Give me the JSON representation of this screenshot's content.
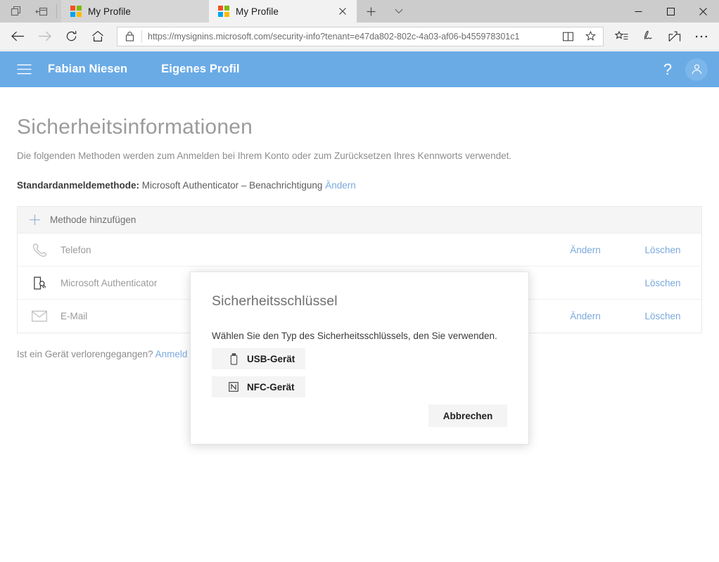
{
  "window": {
    "tabs": [
      {
        "title": "My Profile",
        "active": false,
        "favicon": "microsoft-logo-icon"
      },
      {
        "title": "My Profile",
        "active": true,
        "favicon": "microsoft-logo-icon"
      }
    ],
    "new_tab_label": "+",
    "controls": {
      "minimize": "—",
      "maximize": "☐",
      "close": "✕"
    }
  },
  "toolbar": {
    "back": "back-arrow",
    "forward": "forward-arrow",
    "refresh": "refresh-arrow",
    "home": "home-icon",
    "url": "https://mysignins.microsoft.com/security-info?tenant=e47da802-802c-4a03-af06-b455978301c1",
    "url_domain": "mysignins.microsoft.com",
    "url_scheme": "https://",
    "url_path": "/security-info?tenant=e47da802-802c-4a03-af06-b455978301c1",
    "reading_view": "reading-view-icon",
    "favorite": "star-icon",
    "favorites_hub": "favorites-list-icon",
    "notes": "ink-note-icon",
    "share": "share-icon",
    "more": "⋯"
  },
  "appbar": {
    "menu": "hamburger-icon",
    "brand": "Fabian Niesen",
    "section": "Eigenes Profil",
    "help": "?",
    "avatar": "user-avatar",
    "bg_color": "#6aabe6"
  },
  "main": {
    "title": "Sicherheitsinformationen",
    "description": "Die folgenden Methoden werden zum Anmelden bei Ihrem Konto oder zum Zurücksetzen Ihres Kennworts verwendet.",
    "default_method": {
      "label": "Standardanmeldemethode:",
      "value": "Microsoft Authenticator – Benachrichtigung",
      "change_link": "Ändern"
    },
    "add_method_label": "Methode hinzufügen",
    "methods": [
      {
        "icon": "phone-icon",
        "name": "Telefon",
        "value": "",
        "change": "Ändern",
        "delete": "Löschen"
      },
      {
        "icon": "authenticator-icon",
        "name": "Microsoft Authenticator",
        "value": "",
        "change": "",
        "delete": "Löschen"
      },
      {
        "icon": "email-icon",
        "name": "E-Mail",
        "value": "",
        "change": "Ändern",
        "delete": "Löschen"
      }
    ],
    "lost_device": {
      "question": "Ist ein Gerät verlorengegangen?",
      "link": "Anmeld"
    }
  },
  "modal": {
    "title": "Sicherheitsschlüssel",
    "prompt": "Wählen Sie den Typ des Sicherheitsschlüssels, den Sie verwenden.",
    "options": [
      {
        "icon": "usb-stick-icon",
        "label": "USB-Gerät"
      },
      {
        "icon": "nfc-icon",
        "label": "NFC-Gerät"
      }
    ],
    "cancel_label": "Abbrechen"
  },
  "colors": {
    "accent": "#6aabe6",
    "link": "#7aa9dd",
    "chrome": "#f2f2f2",
    "titlebar": "#cccccc"
  }
}
